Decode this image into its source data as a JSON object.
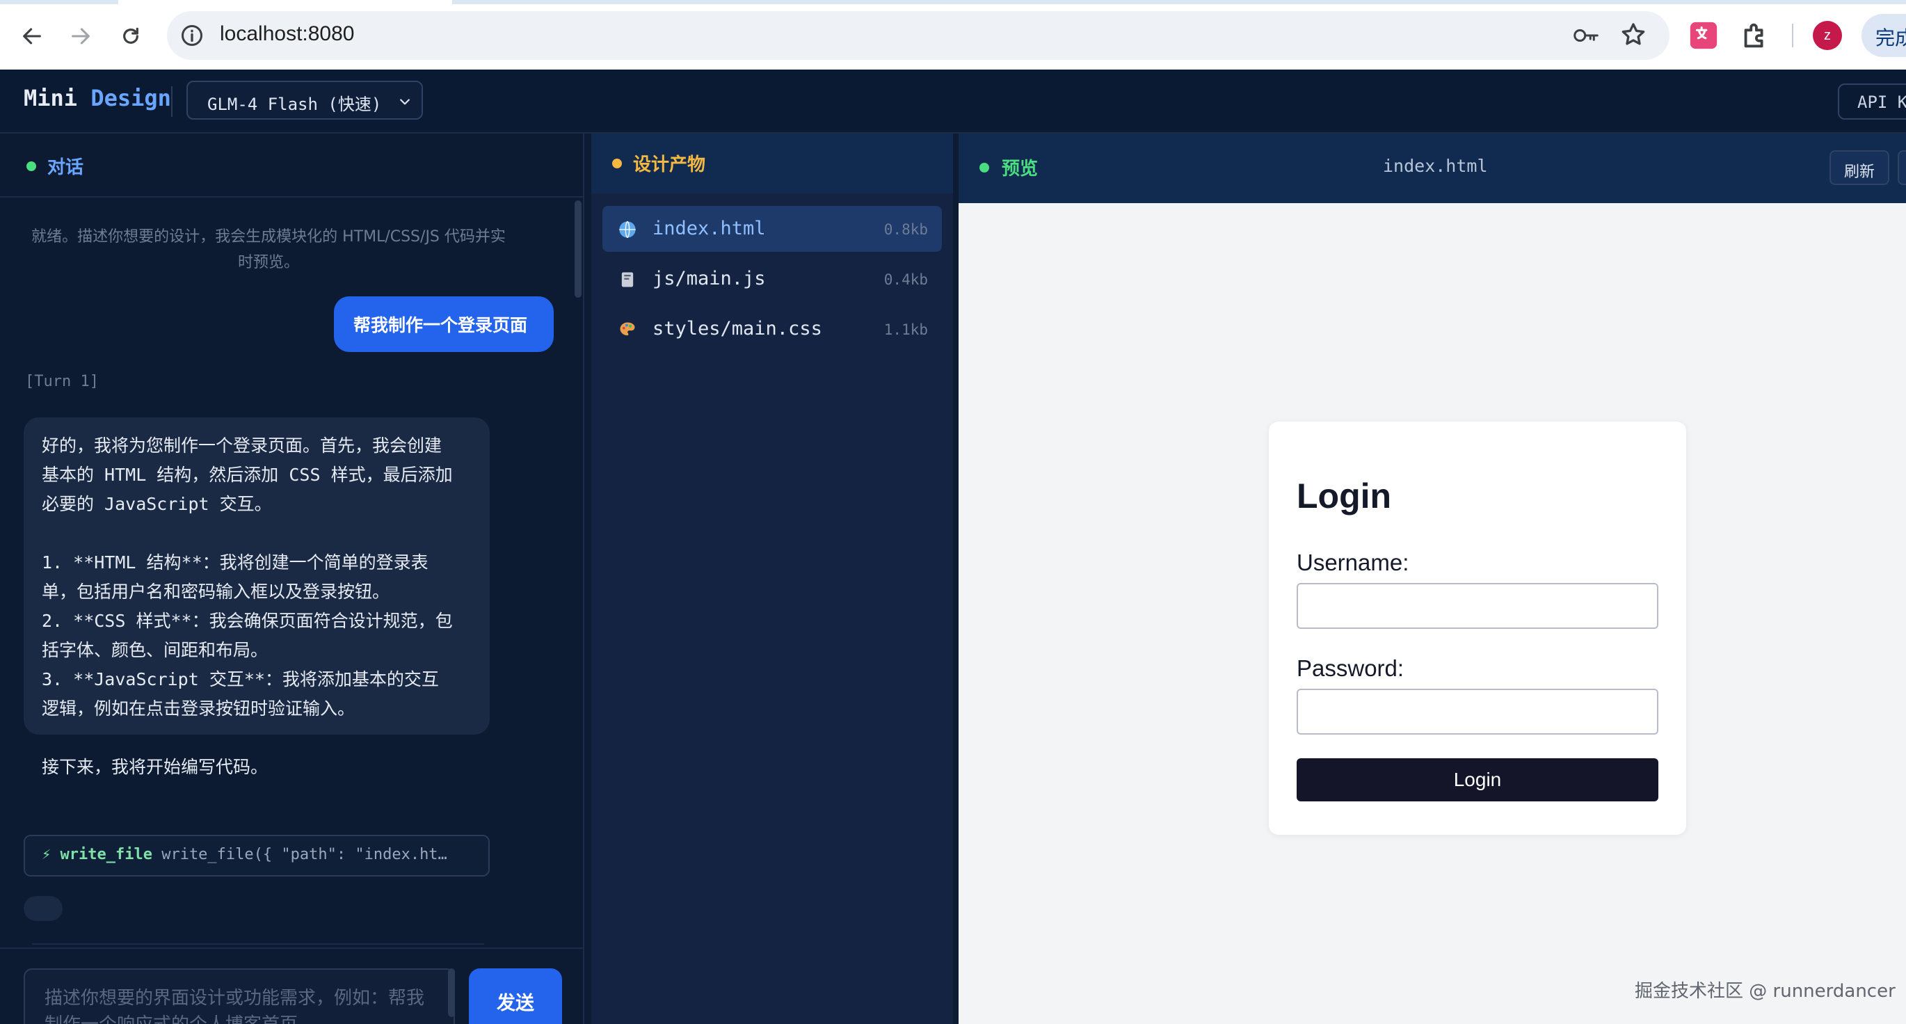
{
  "browser": {
    "url": "localhost:8080",
    "done_label": "完成",
    "avatar_letter": "z",
    "accent": "#1a73e8"
  },
  "header": {
    "brand_part1": "Mini",
    "brand_part2": "Design",
    "model": "GLM-4 Flash (快速)",
    "api_button": "API K"
  },
  "chat": {
    "title": "对话",
    "status": "就绪。描述你想要的设计，我会生成模块化的 HTML/CSS/JS 代码并实时预览。",
    "user_message": "帮我制作一个登录页面",
    "turn_label": "[Turn 1]",
    "assistant_lines": [
      "好的，我将为您制作一个登录页面。首先，我会创建",
      "基本的 HTML 结构，然后添加 CSS 样式，最后添加",
      "必要的 JavaScript 交互。",
      "",
      "1. **HTML 结构**：我将创建一个简单的登录表",
      "单，包括用户名和密码输入框以及登录按钮。",
      "2. **CSS 样式**：我会确保页面符合设计规范，包",
      "括字体、颜色、间距和布局。",
      "3. **JavaScript 交互**：我将添加基本的交互",
      "逻辑，例如在点击登录按钮时验证输入。",
      "",
      "接下来，我将开始编写代码。"
    ],
    "tool_bolt": "⚡",
    "tool_name": "write_file",
    "tool_args": "write_file({ \"path\": \"index.ht…",
    "input_placeholder": "描述你想要的界面设计或功能需求，例如：帮我制作一个响应式的个人博客首页",
    "send_label": "发送"
  },
  "artifacts": {
    "title": "设计产物",
    "files": [
      {
        "name": "index.html",
        "size": "0.8kb",
        "icon": "globe-icon",
        "active": true
      },
      {
        "name": "js/main.js",
        "size": "0.4kb",
        "icon": "scroll-icon",
        "active": false
      },
      {
        "name": "styles/main.css",
        "size": "1.1kb",
        "icon": "palette-icon",
        "active": false
      }
    ]
  },
  "preview": {
    "title": "预览",
    "file": "index.html",
    "refresh_label": "刷新",
    "login": {
      "heading": "Login",
      "username_label": "Username:",
      "password_label": "Password:",
      "button": "Login"
    },
    "watermark": "掘金技术社区 @ runnerdancer"
  },
  "colors": {
    "chat_dot": "#4ade80",
    "artifact_dot": "#f5b942",
    "preview_dot": "#4ade80",
    "primary": "#2463eb"
  }
}
